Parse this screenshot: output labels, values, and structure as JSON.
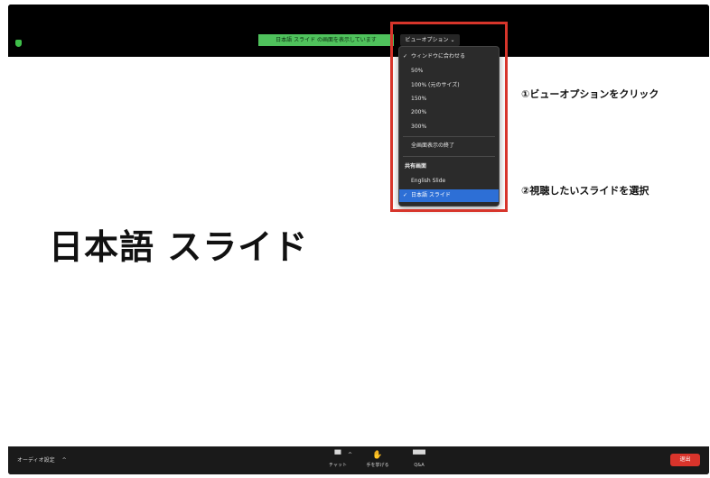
{
  "top_bar": {
    "share_banner": "日本語 スライド の画面を表示しています",
    "view_options": "ビューオプション"
  },
  "slide": {
    "title": "日本語 スライド"
  },
  "view_menu": {
    "items": [
      {
        "label": "ウィンドウに合わせる",
        "checked": true
      },
      {
        "label": "50%"
      },
      {
        "label": "100% (元のサイズ)"
      },
      {
        "label": "150%"
      },
      {
        "label": "200%"
      },
      {
        "label": "300%"
      },
      {
        "label": "全画面表示の終了"
      },
      {
        "label": "共有画面"
      },
      {
        "label": "English Slide"
      },
      {
        "label": "日本語 スライド",
        "checked": true,
        "selected": true
      }
    ]
  },
  "annotations": {
    "step1": "①ビューオプションをクリック",
    "step2": "②視聴したいスライドを選択"
  },
  "toolbar": {
    "audio_settings": "オーディオ設定",
    "chat": "チャット",
    "raise_hand": "手を挙げる",
    "qa": "Q&A",
    "leave": "退出"
  },
  "colors": {
    "highlight": "#d7352b",
    "share_banner": "#4fc25c",
    "selected_item": "#2d6fd6",
    "leave_button": "#d9342b"
  },
  "icons": {
    "security": "shield-icon",
    "check": "check-icon",
    "chat": "chat-icon",
    "raise_hand": "hand-icon",
    "qa": "qa-icon",
    "chevron": "chevron-down-icon",
    "caret_up": "caret-up-icon"
  }
}
